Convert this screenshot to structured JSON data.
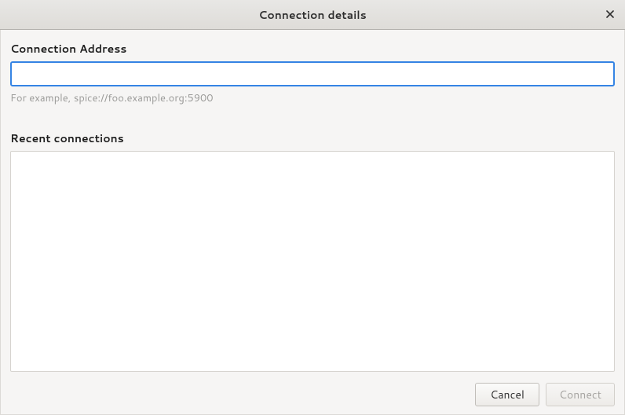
{
  "titlebar": {
    "title": "Connection details"
  },
  "address": {
    "label": "Connection Address",
    "value": "",
    "hint": "For example, spice://foo.example.org:5900"
  },
  "recent": {
    "label": "Recent connections",
    "items": []
  },
  "buttons": {
    "cancel": "Cancel",
    "connect": "Connect"
  }
}
